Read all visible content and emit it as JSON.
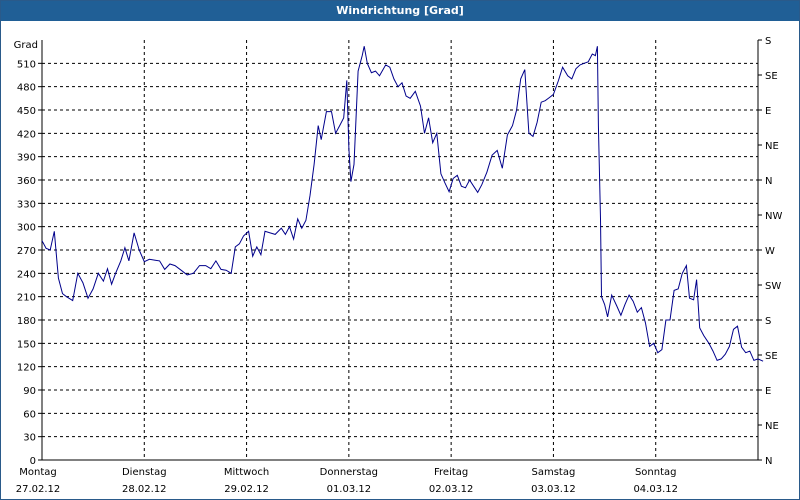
{
  "window": {
    "title": "Windrichtung [Grad]"
  },
  "chart_data": {
    "type": "line",
    "title": "Windrichtung [Grad]",
    "ylabel": "Grad",
    "ylim": [
      0,
      540
    ],
    "yticks": [
      0,
      30,
      60,
      90,
      120,
      150,
      180,
      210,
      240,
      270,
      300,
      330,
      360,
      390,
      420,
      450,
      480,
      510
    ],
    "right_ticks": [
      {
        "value": 0,
        "label": "N"
      },
      {
        "value": 45,
        "label": "NE"
      },
      {
        "value": 90,
        "label": "E"
      },
      {
        "value": 135,
        "label": "SE"
      },
      {
        "value": 180,
        "label": "S"
      },
      {
        "value": 225,
        "label": "SW"
      },
      {
        "value": 270,
        "label": "W"
      },
      {
        "value": 315,
        "label": "NW"
      },
      {
        "value": 360,
        "label": "N"
      },
      {
        "value": 405,
        "label": "NE"
      },
      {
        "value": 450,
        "label": "E"
      },
      {
        "value": 495,
        "label": "SE"
      },
      {
        "value": 540,
        "label": "S"
      }
    ],
    "xlim": [
      0,
      7
    ],
    "days": [
      {
        "day": "Montag",
        "date": "27.02.12"
      },
      {
        "day": "Dienstag",
        "date": "28.02.12"
      },
      {
        "day": "Mittwoch",
        "date": "29.02.12"
      },
      {
        "day": "Donnerstag",
        "date": "01.03.12"
      },
      {
        "day": "Freitag",
        "date": "02.03.12"
      },
      {
        "day": "Samstag",
        "date": "03.03.12"
      },
      {
        "day": "Sonntag",
        "date": "04.03.12"
      }
    ],
    "grid": true,
    "series": [
      {
        "color": "#00008b",
        "points": [
          [
            0.0,
            282
          ],
          [
            0.04,
            272
          ],
          [
            0.08,
            270
          ],
          [
            0.12,
            294
          ],
          [
            0.16,
            234
          ],
          [
            0.2,
            214
          ],
          [
            0.24,
            210
          ],
          [
            0.3,
            205
          ],
          [
            0.35,
            240
          ],
          [
            0.4,
            228
          ],
          [
            0.45,
            208
          ],
          [
            0.5,
            220
          ],
          [
            0.55,
            240
          ],
          [
            0.6,
            230
          ],
          [
            0.64,
            246
          ],
          [
            0.68,
            226
          ],
          [
            0.72,
            240
          ],
          [
            0.77,
            256
          ],
          [
            0.81,
            273
          ],
          [
            0.85,
            256
          ],
          [
            0.9,
            292
          ],
          [
            0.95,
            270
          ],
          [
            1.0,
            255
          ],
          [
            1.05,
            258
          ],
          [
            1.1,
            257
          ],
          [
            1.15,
            256
          ],
          [
            1.2,
            245
          ],
          [
            1.25,
            252
          ],
          [
            1.3,
            250
          ],
          [
            1.36,
            244
          ],
          [
            1.42,
            238
          ],
          [
            1.48,
            240
          ],
          [
            1.54,
            250
          ],
          [
            1.6,
            250
          ],
          [
            1.65,
            246
          ],
          [
            1.7,
            256
          ],
          [
            1.75,
            245
          ],
          [
            1.8,
            244
          ],
          [
            1.85,
            240
          ],
          [
            1.89,
            274
          ],
          [
            1.93,
            278
          ],
          [
            1.97,
            288
          ],
          [
            2.02,
            294
          ],
          [
            2.06,
            262
          ],
          [
            2.1,
            274
          ],
          [
            2.14,
            264
          ],
          [
            2.18,
            294
          ],
          [
            2.23,
            292
          ],
          [
            2.28,
            290
          ],
          [
            2.34,
            298
          ],
          [
            2.38,
            290
          ],
          [
            2.42,
            300
          ],
          [
            2.46,
            284
          ],
          [
            2.5,
            310
          ],
          [
            2.54,
            298
          ],
          [
            2.58,
            308
          ],
          [
            2.62,
            340
          ],
          [
            2.66,
            380
          ],
          [
            2.7,
            430
          ],
          [
            2.73,
            412
          ],
          [
            2.78,
            448
          ],
          [
            2.83,
            448
          ],
          [
            2.87,
            420
          ],
          [
            2.91,
            430
          ],
          [
            2.95,
            440
          ],
          [
            2.98,
            488
          ],
          [
            3.0,
            400
          ],
          [
            3.02,
            358
          ],
          [
            3.05,
            380
          ],
          [
            3.09,
            500
          ],
          [
            3.13,
            520
          ],
          [
            3.15,
            532
          ],
          [
            3.18,
            510
          ],
          [
            3.22,
            498
          ],
          [
            3.26,
            500
          ],
          [
            3.3,
            494
          ],
          [
            3.36,
            508
          ],
          [
            3.4,
            505
          ],
          [
            3.44,
            490
          ],
          [
            3.48,
            480
          ],
          [
            3.52,
            485
          ],
          [
            3.56,
            468
          ],
          [
            3.6,
            465
          ],
          [
            3.65,
            474
          ],
          [
            3.7,
            455
          ],
          [
            3.74,
            420
          ],
          [
            3.78,
            440
          ],
          [
            3.82,
            408
          ],
          [
            3.86,
            420
          ],
          [
            3.9,
            368
          ],
          [
            3.94,
            356
          ],
          [
            3.98,
            345
          ],
          [
            4.02,
            362
          ],
          [
            4.06,
            366
          ],
          [
            4.1,
            352
          ],
          [
            4.14,
            350
          ],
          [
            4.18,
            360
          ],
          [
            4.22,
            352
          ],
          [
            4.26,
            344
          ],
          [
            4.3,
            354
          ],
          [
            4.35,
            370
          ],
          [
            4.4,
            392
          ],
          [
            4.45,
            398
          ],
          [
            4.5,
            375
          ],
          [
            4.55,
            418
          ],
          [
            4.6,
            430
          ],
          [
            4.64,
            450
          ],
          [
            4.68,
            490
          ],
          [
            4.72,
            502
          ],
          [
            4.76,
            420
          ],
          [
            4.8,
            416
          ],
          [
            4.84,
            434
          ],
          [
            4.88,
            460
          ],
          [
            4.92,
            462
          ],
          [
            4.96,
            466
          ],
          [
            5.0,
            470
          ],
          [
            5.05,
            488
          ],
          [
            5.09,
            505
          ],
          [
            5.14,
            494
          ],
          [
            5.18,
            490
          ],
          [
            5.22,
            503
          ],
          [
            5.26,
            508
          ],
          [
            5.3,
            510
          ],
          [
            5.34,
            512
          ],
          [
            5.38,
            522
          ],
          [
            5.41,
            520
          ],
          [
            5.43,
            532
          ],
          [
            5.44,
            430
          ],
          [
            5.46,
            310
          ],
          [
            5.47,
            210
          ],
          [
            5.5,
            200
          ],
          [
            5.53,
            184
          ],
          [
            5.57,
            212
          ],
          [
            5.62,
            198
          ],
          [
            5.66,
            186
          ],
          [
            5.7,
            200
          ],
          [
            5.74,
            212
          ],
          [
            5.78,
            204
          ],
          [
            5.82,
            190
          ],
          [
            5.86,
            196
          ],
          [
            5.9,
            176
          ],
          [
            5.94,
            146
          ],
          [
            5.98,
            150
          ],
          [
            6.02,
            138
          ],
          [
            6.06,
            142
          ],
          [
            6.1,
            180
          ],
          [
            6.14,
            180
          ],
          [
            6.18,
            218
          ],
          [
            6.22,
            220
          ],
          [
            6.26,
            240
          ],
          [
            6.3,
            250
          ],
          [
            6.33,
            208
          ],
          [
            6.37,
            206
          ],
          [
            6.4,
            232
          ],
          [
            6.43,
            170
          ],
          [
            6.47,
            160
          ],
          [
            6.52,
            150
          ],
          [
            6.56,
            140
          ],
          [
            6.6,
            128
          ],
          [
            6.64,
            130
          ],
          [
            6.68,
            136
          ],
          [
            6.72,
            146
          ],
          [
            6.76,
            168
          ],
          [
            6.8,
            172
          ],
          [
            6.84,
            145
          ],
          [
            6.88,
            138
          ],
          [
            6.92,
            140
          ],
          [
            6.96,
            128
          ],
          [
            7.0,
            130
          ],
          [
            7.05,
            127
          ]
        ]
      }
    ]
  }
}
